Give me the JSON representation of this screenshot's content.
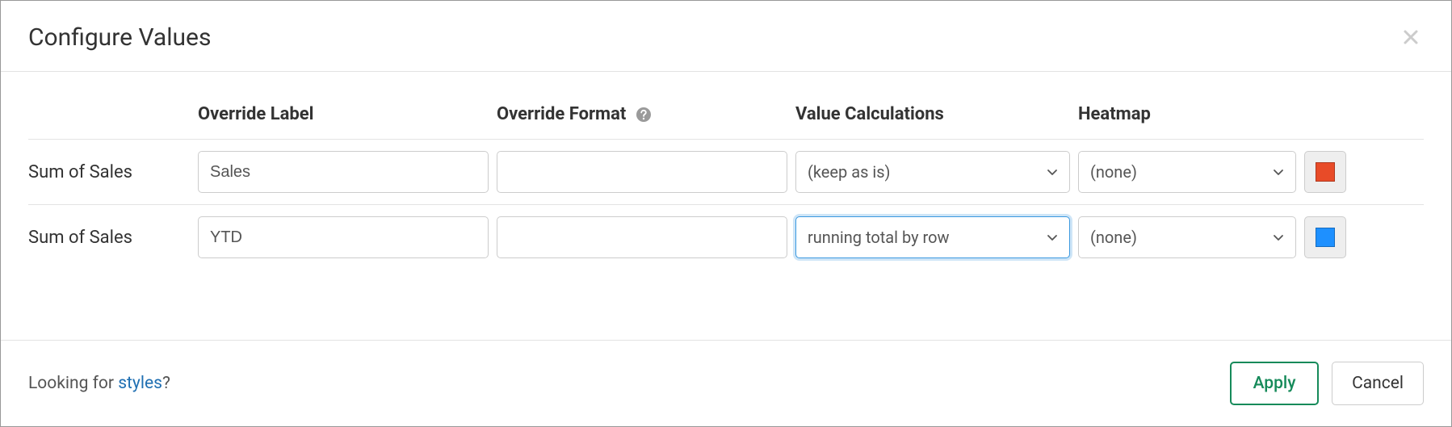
{
  "dialog": {
    "title": "Configure Values"
  },
  "columns": {
    "override_label": "Override Label",
    "override_format": "Override Format",
    "value_calculations": "Value Calculations",
    "heatmap": "Heatmap"
  },
  "rows": [
    {
      "name": "Sum of Sales",
      "override_label": "Sales",
      "override_format": "",
      "value_calc": "(keep as is)",
      "heatmap": "(none)",
      "swatch_color": "#e84b28",
      "calc_focused": false
    },
    {
      "name": "Sum of Sales",
      "override_label": "YTD",
      "override_format": "",
      "value_calc": "running total by row",
      "heatmap": "(none)",
      "swatch_color": "#1e90ff",
      "calc_focused": true
    }
  ],
  "footer": {
    "hint_prefix": "Looking for ",
    "hint_link": "styles",
    "hint_suffix": "?",
    "apply": "Apply",
    "cancel": "Cancel"
  }
}
